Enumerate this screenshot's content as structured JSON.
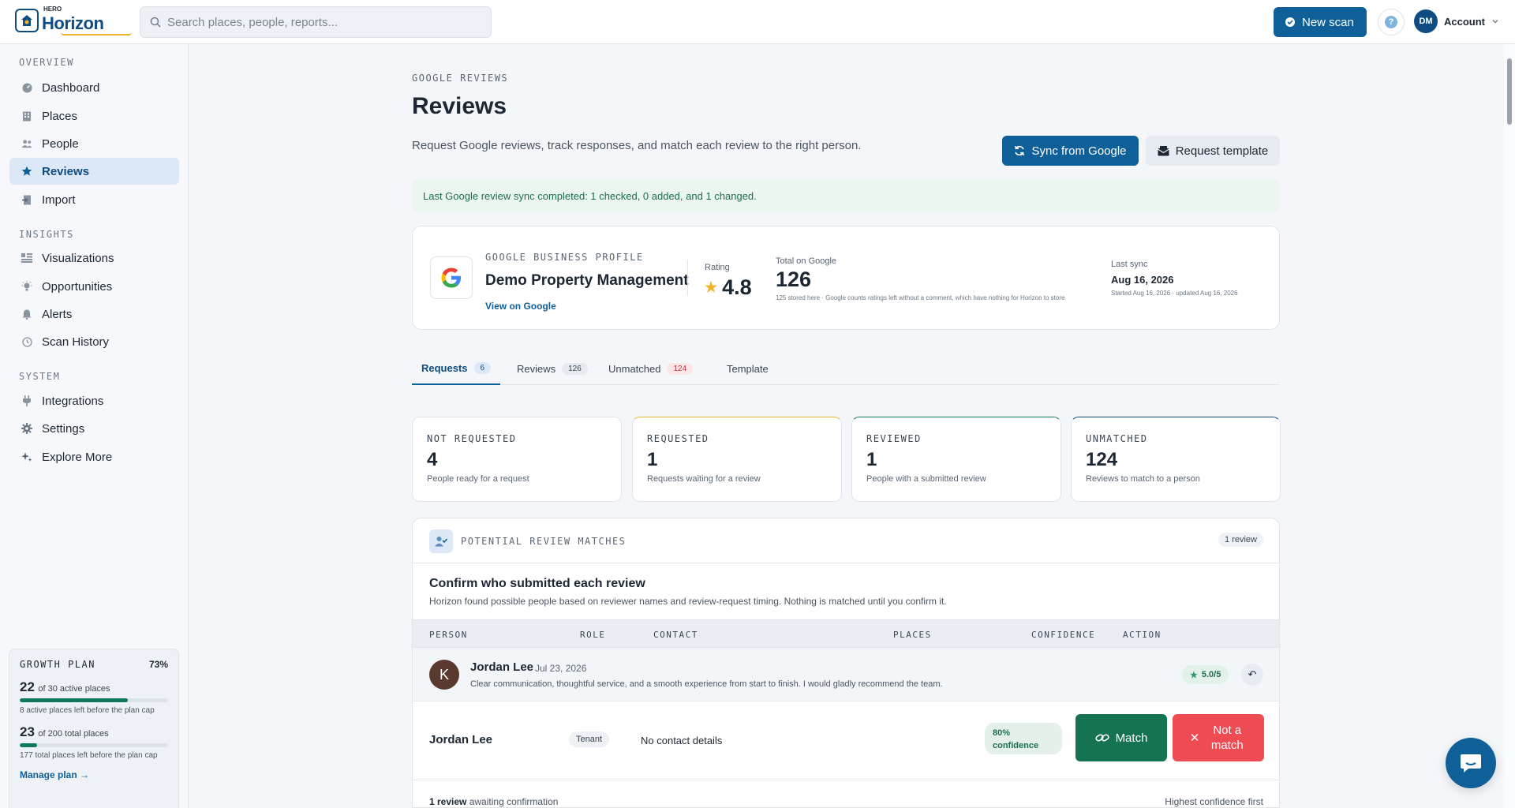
{
  "header": {
    "logo_small": "HERO",
    "logo_name": "Horizon",
    "search_placeholder": "Search places, people, reports...",
    "new_scan_label": "New scan",
    "help_label": "?",
    "account_initials": "DM",
    "account_label": "Account"
  },
  "sidebar": {
    "sections": [
      {
        "label": "OVERVIEW",
        "items": [
          {
            "label": "Dashboard",
            "icon": "dashboard-icon"
          },
          {
            "label": "Places",
            "icon": "building-icon"
          },
          {
            "label": "People",
            "icon": "people-icon"
          },
          {
            "label": "Reviews",
            "icon": "star-icon",
            "active": true
          },
          {
            "label": "Import",
            "icon": "import-icon"
          }
        ]
      },
      {
        "label": "INSIGHTS",
        "items": [
          {
            "label": "Visualizations",
            "icon": "chart-icon"
          },
          {
            "label": "Opportunities",
            "icon": "bulb-icon"
          },
          {
            "label": "Alerts",
            "icon": "bell-icon"
          },
          {
            "label": "Scan History",
            "icon": "history-icon"
          }
        ]
      },
      {
        "label": "SYSTEM",
        "items": [
          {
            "label": "Integrations",
            "icon": "plug-icon"
          },
          {
            "label": "Settings",
            "icon": "gear-icon"
          },
          {
            "label": "Explore More",
            "icon": "sparkle-icon"
          }
        ]
      }
    ],
    "plan": {
      "title": "GROWTH PLAN",
      "percent": "73%",
      "active_num": "22",
      "active_of": "of 30 active places",
      "active_fraction": 0.73,
      "active_note": "8 active places left before the plan cap",
      "total_num": "23",
      "total_of": "of 200 total places",
      "total_fraction": 0.115,
      "total_note": "177 total places left before the plan cap",
      "manage_label": "Manage plan"
    }
  },
  "page": {
    "eyebrow": "GOOGLE REVIEWS",
    "title": "Reviews",
    "subtitle": "Request Google reviews, track responses, and match each review to the right person.",
    "sync_label": "Sync from Google",
    "template_label": "Request template",
    "banner": "Last Google review sync completed: 1 checked, 0 added, and 1 changed."
  },
  "profile": {
    "logo_letter": "G",
    "eyebrow": "GOOGLE BUSINESS PROFILE",
    "name": "Demo Property Management",
    "link": "View on Google",
    "rating_label": "Rating",
    "rating": "4.8",
    "total_label": "Total on Google",
    "total": "126",
    "total_note": "125 stored here · Google counts ratings left without a comment, which have nothing for Horizon to store",
    "sync_label": "Last sync",
    "sync_date": "Aug 16, 2026",
    "sync_note": "Started Aug 16, 2026 · updated Aug 16, 2026"
  },
  "tabs": [
    {
      "label": "Requests",
      "count": "6",
      "active": true
    },
    {
      "label": "Reviews",
      "count": "126"
    },
    {
      "label": "Unmatched",
      "count": "124",
      "alert": true
    },
    {
      "label": "Template",
      "count": ""
    }
  ],
  "stats": [
    {
      "label": "NOT REQUESTED",
      "value": "4",
      "sub": "People ready for a request",
      "accent": ""
    },
    {
      "label": "REQUESTED",
      "value": "1",
      "sub": "Requests waiting for a review",
      "accent": "#f0b429"
    },
    {
      "label": "REVIEWED",
      "value": "1",
      "sub": "People with a submitted review",
      "accent": "#117a5a"
    },
    {
      "label": "UNMATCHED",
      "value": "124",
      "sub": "Reviews to match to a person",
      "accent": "#0f4c81"
    }
  ],
  "matches": {
    "label": "POTENTIAL REVIEW MATCHES",
    "count": "1 review",
    "title": "Confirm who submitted each review",
    "description": "Horizon found possible people based on reviewer names and review-request timing. Nothing is matched until you confirm it.",
    "columns": [
      "PERSON",
      "ROLE",
      "CONTACT",
      "PLACES",
      "CONFIDENCE",
      "ACTION"
    ],
    "review": {
      "initial": "K",
      "name": "Jordan Lee",
      "date": "Jul 23, 2026",
      "text": "Clear communication, thoughtful service, and a smooth experience from start to finish. I would gladly recommend the team.",
      "score": "5.0/5"
    },
    "candidate": {
      "name": "Jordan Lee",
      "role": "Tenant",
      "contact": "No contact details",
      "confidence_pct": "80%",
      "confidence_word": "confidence",
      "match_label": "Match",
      "not_match_label": "Not a match"
    },
    "footer_count": "1 review",
    "footer_text": "awaiting confirmation",
    "footer_sort": "Highest confidence first"
  },
  "colors": {
    "primary": "#0f5f98",
    "success": "#167352",
    "danger": "#ef4b53",
    "warning": "#f0b429"
  }
}
